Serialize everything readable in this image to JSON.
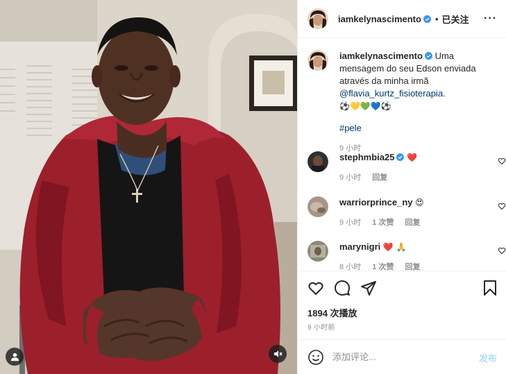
{
  "post": {
    "author": "iamkelynascimento",
    "follow_status": "已关注",
    "more_icon": "more-dots-icon"
  },
  "caption": {
    "username": "iamkelynascimento",
    "text": "Uma mensagem do seu Edson enviada através da minha irmã",
    "mention": "@flavia_kurtz_fisioterapia",
    "period": ".",
    "emoji_line": "⚽💛💚💙⚽",
    "hashtag": "#pele",
    "time": "9 小时"
  },
  "comments": [
    {
      "username": "stephmbia25",
      "verified": true,
      "text": "❤️",
      "time": "9 小时",
      "likes": "",
      "reply": "回复",
      "avatar_color": "#3b3b3b"
    },
    {
      "username": "warriorprince_ny",
      "verified": false,
      "text": "😍",
      "time": "9 小时",
      "likes": "1 次赞",
      "reply": "回复",
      "avatar_color": "#a89586"
    },
    {
      "username": "marynigri",
      "verified": false,
      "text": "❤️ 🙏",
      "time": "8 小时",
      "likes": "1 次赞",
      "reply": "回复",
      "avatar_color": "#8a8a7a"
    }
  ],
  "actions": {
    "views": "1894 次播放",
    "time_ago": "9 小时前"
  },
  "add_comment": {
    "placeholder": "添加评论...",
    "post_label": "发布"
  },
  "colors": {
    "verified_blue": "#3897f0",
    "link_blue": "#00376b",
    "heart_red": "#ed4956",
    "muted_gray": "#8e8e8e",
    "post_disabled": "#b2dffc"
  }
}
